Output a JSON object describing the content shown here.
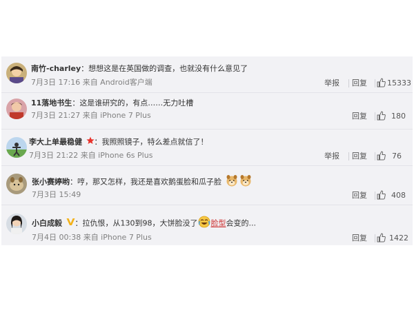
{
  "comments": [
    {
      "user": "南竹-charley",
      "colon": "：",
      "text": "想想这是在英国做的调查，也就没有什么意见了",
      "time": "7月3日 17:16 来自 Android客户端",
      "actions": {
        "report": "举报",
        "reply": "回复",
        "likes": "15333"
      }
    },
    {
      "user": "11落地书生",
      "colon": "：",
      "text": "这是谁研究的，有点……无力吐槽",
      "time": "7月3日 21:27 来自 iPhone 7 Plus",
      "actions": {
        "reply": "回复",
        "likes": "180"
      }
    },
    {
      "user": "李大上单最稳健",
      "colon": "：",
      "text": "我照照镜子，特么差点就信了！",
      "time": "7月3日 21:22 来自 iPhone 6s Plus",
      "actions": {
        "report": "举报",
        "reply": "回复",
        "likes": "76"
      }
    },
    {
      "user": "张小赛婷哟",
      "colon": "：",
      "text": "哼，那又怎样，我还是喜欢鹅蛋脸和瓜子脸",
      "time": "7月3日 15:49",
      "actions": {
        "reply": "回复",
        "likes": "408"
      }
    },
    {
      "user": "小白成毅",
      "colon": "：",
      "text_before": "拉仇恨，从130到98，大饼脸没了",
      "link": "脸型",
      "text_after": "会变的...",
      "time": "7月4日 00:38 来自 iPhone 7 Plus",
      "actions": {
        "reply": "回复",
        "likes": "1422"
      }
    }
  ],
  "colors": {
    "panel_bg": "#f2f2f5",
    "link_red": "#cc3333",
    "vip_star": "#e8322b",
    "verified_v": "#f3b21b",
    "time_gray": "#808080"
  },
  "icons": [
    "thumb-up-icon",
    "star-badge-icon",
    "verified-v-icon",
    "dog-emoji-icon",
    "laugh-cry-emoji-icon"
  ]
}
